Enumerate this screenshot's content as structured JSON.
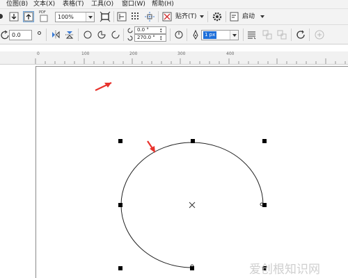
{
  "menu": {
    "items": [
      "位图(B)",
      "文本(X)",
      "表格(T)",
      "工具(O)",
      "窗口(W)",
      "帮助(H)"
    ]
  },
  "toolbar1": {
    "pdf_label": "PDF",
    "zoom_value": "100%",
    "snap_label": "贴齐(T)",
    "launch_label": "启动"
  },
  "toolbar2": {
    "position_value": "0.0",
    "start_angle": "0.0 °",
    "end_angle": "270.0 °",
    "outline_width": "1 px"
  },
  "ruler": {
    "ticks": [
      "0",
      "100",
      "200",
      "300",
      "400"
    ]
  },
  "watermark": {
    "text": "爱创根知识网"
  },
  "colors": {
    "annotation_arrow": "#e8322c",
    "selection_handle": "#000000",
    "outline_width_highlight": "#1e6fd9"
  },
  "icons": [
    "import-icon",
    "export-icon",
    "pdf-icon",
    "fullscreen-icon",
    "options-icon",
    "grid-icon",
    "guidelines-icon",
    "snap-icon",
    "settings-icon",
    "launch-icon",
    "rotate-icon",
    "mirror-h-icon",
    "mirror-v-icon",
    "circle-icon",
    "pie-icon",
    "arc-icon",
    "direction-icon",
    "pen-icon",
    "text-wrap-icon",
    "to-front-icon",
    "to-back-icon",
    "convert-icon",
    "add-icon"
  ]
}
